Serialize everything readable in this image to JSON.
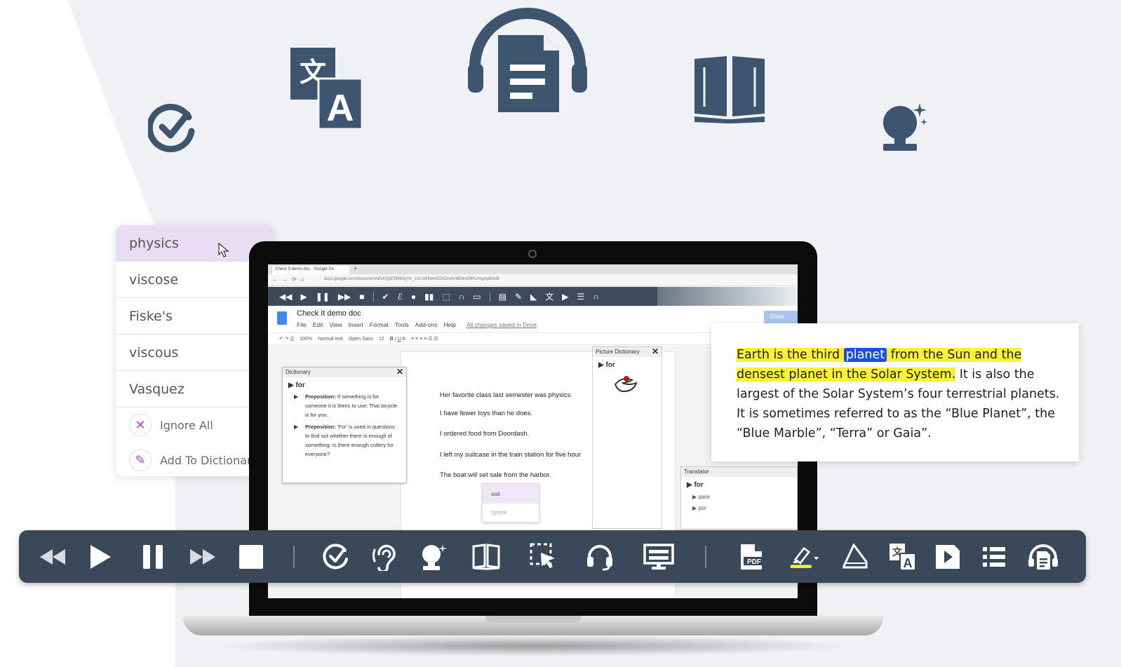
{
  "suggestions": {
    "items": [
      "physics",
      "viscose",
      "Fiske's",
      "viscous",
      "Vasquez"
    ],
    "ignore_all_label": "Ignore All",
    "add_to_dictionary_label": "Add To Dictionary"
  },
  "browser": {
    "tab_title": "Check It demo doc - Google Do",
    "url": "docs.google.com/document/d/1KQsESNK5yYA_UJ-sSHlwmO0XDo4V4EMnDfIPL/mpAp8/edit"
  },
  "doc": {
    "title": "Check It demo doc",
    "menu": [
      "File",
      "Edit",
      "View",
      "Insert",
      "Format",
      "Tools",
      "Add-ons",
      "Help"
    ],
    "saved_label": "All changes saved in Drive",
    "share_label": "Share",
    "format_bar": [
      "100%",
      "Normal text",
      "Open Sans",
      "12"
    ],
    "lines": [
      "Her favorite class last semester was physics.",
      "I have fewer toys than he does.",
      "I ordered food from Doordash.",
      "I left my suitcase in the train station for five hour",
      "The boat will set sale from the harbor."
    ]
  },
  "dictionary_panel": {
    "title": "Dictionary",
    "word": "for",
    "definitions": [
      {
        "label": "Preposition:",
        "text": "If something is for someone it is theirs to use; That bicycle is for you."
      },
      {
        "label": "Preposition:",
        "text": "'For' is used in questions to find out whether there is enough of something: Is there enough cutlery for everyone?"
      }
    ]
  },
  "picture_panel": {
    "title": "Picture Dictionary",
    "word": "for"
  },
  "translator_panel": {
    "title": "Translator",
    "word": "for",
    "rows": [
      "para",
      "por"
    ]
  },
  "spell_popup": {
    "suggestion": "sail",
    "ignore_label": "Ignore"
  },
  "text_card": {
    "highlight_before": "Earth is the third ",
    "current_word": "planet",
    "highlight_after": " from the Sun and the densest planet in the Solar System.",
    "rest": " It is also the largest of the Solar System’s four terrestrial planets. It is sometimes referred to as the “Blue Planet”, the “Blue Marble”, “Terra” or Gaia”."
  },
  "toolbar": {
    "buttons": [
      "rewind",
      "play",
      "pause",
      "fast-forward",
      "stop",
      "check-it",
      "sound-it-out",
      "prediction",
      "dictionary",
      "screen-selection",
      "audio-maker",
      "screen-masking",
      "pdf",
      "highlighter",
      "vocabulary",
      "translator",
      "talk-and-type",
      "voice-note",
      "audio-doc"
    ]
  },
  "colors": {
    "navy": "#3b4859",
    "icon": "#3e5570",
    "highlight": "#fff13b",
    "current_word": "#1a4fe0",
    "accent_purple": "#9b4dca"
  }
}
